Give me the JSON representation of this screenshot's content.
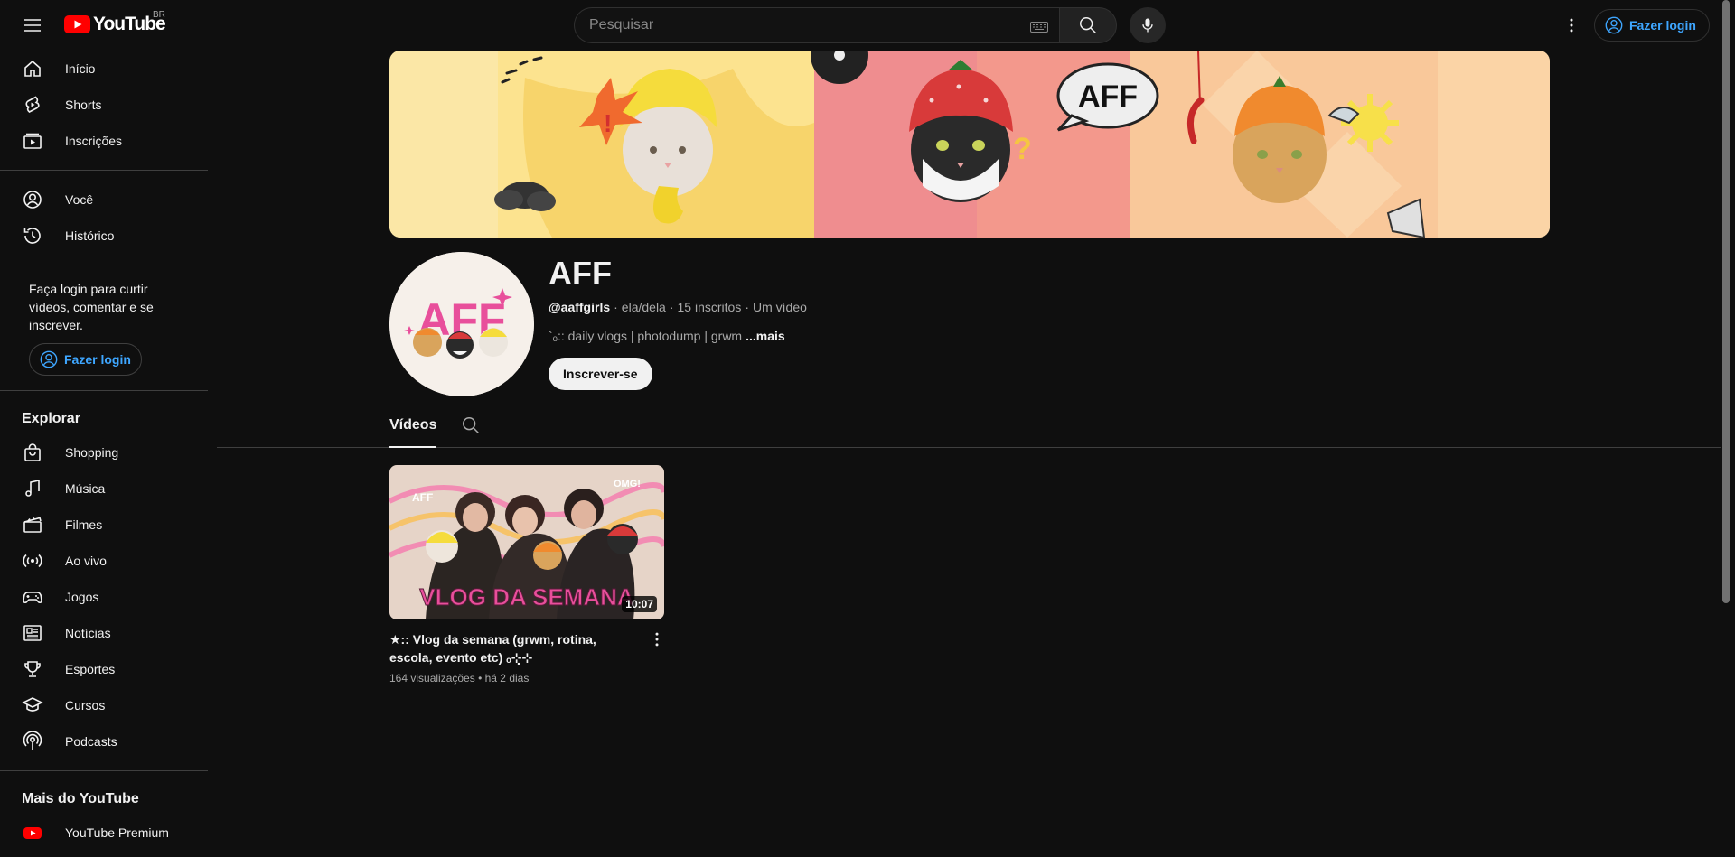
{
  "header": {
    "logo_text": "YouTube",
    "country": "BR",
    "search_placeholder": "Pesquisar",
    "login_label": "Fazer login"
  },
  "sidebar": {
    "main_items": [
      {
        "label": "Início",
        "icon": "home-icon"
      },
      {
        "label": "Shorts",
        "icon": "shorts-icon"
      },
      {
        "label": "Inscrições",
        "icon": "subscriptions-icon"
      }
    ],
    "you_items": [
      {
        "label": "Você",
        "icon": "user-icon"
      },
      {
        "label": "Histórico",
        "icon": "history-icon"
      }
    ],
    "login_note": "Faça login para curtir vídeos, comentar e se inscrever.",
    "login_label": "Fazer login",
    "explore_title": "Explorar",
    "explore_items": [
      {
        "label": "Shopping",
        "icon": "shopping-bag-icon"
      },
      {
        "label": "Música",
        "icon": "music-note-icon"
      },
      {
        "label": "Filmes",
        "icon": "clapperboard-icon"
      },
      {
        "label": "Ao vivo",
        "icon": "live-icon"
      },
      {
        "label": "Jogos",
        "icon": "gamepad-icon"
      },
      {
        "label": "Notícias",
        "icon": "news-icon"
      },
      {
        "label": "Esportes",
        "icon": "trophy-icon"
      },
      {
        "label": "Cursos",
        "icon": "graduation-cap-icon"
      },
      {
        "label": "Podcasts",
        "icon": "podcast-icon"
      }
    ],
    "more_title": "Mais do YouTube",
    "more_items": [
      {
        "label": "YouTube Premium",
        "icon": "youtube-premium-icon"
      }
    ]
  },
  "channel": {
    "name": "AFF",
    "handle": "@aaffgirls",
    "pronouns": "ela/dela",
    "subscribers": "15 inscritos",
    "video_count": "Um vídeo",
    "description": "`ₒ:: daily vlogs | photodump | grwm",
    "more_label": "...mais",
    "subscribe_label": "Inscrever-se",
    "avatar_text": "AFF"
  },
  "tabs": {
    "videos_label": "Vídeos"
  },
  "video": {
    "title": "★:: Vlog da semana (grwm, rotina, escola, evento etc) ₒ⊹̣⊹",
    "views": "164 visualizações",
    "age": "há 2 dias",
    "duration": "10:07",
    "thumb_text": "VLOG DA SEMANA",
    "thumb_tag_left": "AFF",
    "thumb_tag_right": "OMG!"
  },
  "banner": {
    "bubble_text": "AFF"
  },
  "colors": {
    "brand_red": "#ff0000",
    "link_blue": "#3ea6ff",
    "accent_pink": "#e84f9b"
  }
}
